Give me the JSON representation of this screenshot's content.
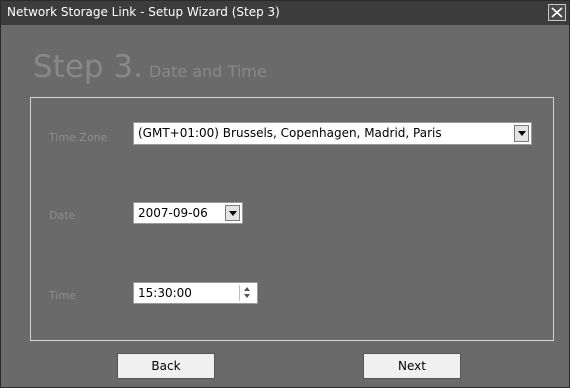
{
  "window": {
    "title": "Network Storage Link - Setup Wizard (Step 3)"
  },
  "step": {
    "label": "Step 3.",
    "subtitle": "Date and Time"
  },
  "fields": {
    "time_zone": {
      "label": "Time Zone",
      "value": "(GMT+01:00) Brussels, Copenhagen, Madrid, Paris"
    },
    "date": {
      "label": "Date",
      "value": "2007-09-06"
    },
    "time": {
      "label": "Time",
      "value": "15:30:00"
    }
  },
  "buttons": {
    "back": "Back",
    "next": "Next"
  },
  "icons": {
    "close": "close-icon",
    "dropdown": "chevron-down-icon",
    "spin_up": "spin-up-icon",
    "spin_down": "spin-down-icon"
  }
}
